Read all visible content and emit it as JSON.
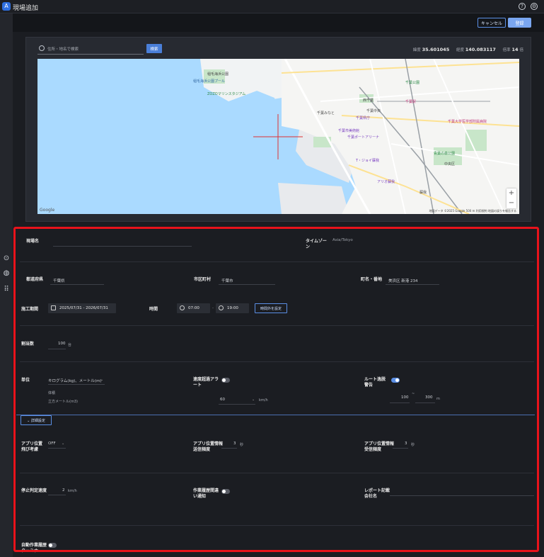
{
  "window": {
    "title": "現場追加",
    "logo_glyph": "A"
  },
  "actions": {
    "cancel_label": "キャンセル",
    "save_label": "登録"
  },
  "map_search": {
    "placeholder": "住所・地名で検索",
    "button_label": "検索",
    "lat_label": "緯度",
    "lat_value": "35.601045",
    "lng_label": "経度",
    "lng_value": "140.083117",
    "zoom_label": "倍率",
    "zoom_value": "14",
    "zoom_unit": "倍"
  },
  "map": {
    "labels": [
      {
        "text": "稲毛海浜公園",
        "cls": ""
      },
      {
        "text": "稲毛海浜公園プール",
        "cls": ""
      },
      {
        "text": "ZOZOマリンスタジアム",
        "cls": "gr"
      },
      {
        "text": "千葉ポートアリーナ",
        "cls": "pu"
      },
      {
        "text": "千葉市美術館",
        "cls": "pu"
      },
      {
        "text": "千葉県庁",
        "cls": "pu"
      },
      {
        "text": "千葉中央",
        "cls": ""
      },
      {
        "text": "千葉駅",
        "cls": "pk"
      },
      {
        "text": "千葉公園",
        "cls": "gr"
      },
      {
        "text": "青葉の森公園",
        "cls": "gr"
      },
      {
        "text": "T・ジョイ蘇我",
        "cls": "pu"
      },
      {
        "text": "アリオ蘇我",
        "cls": "pu"
      },
      {
        "text": "中央区",
        "cls": ""
      },
      {
        "text": "千葉みなと",
        "cls": ""
      },
      {
        "text": "西千葉",
        "cls": ""
      },
      {
        "text": "千葉大学医学部附属病院",
        "cls": "pk"
      },
      {
        "text": "蘇我",
        "cls": ""
      }
    ],
    "google_label": "Google",
    "attribution": "地図データ ©2025 Google  500 m  利用規約  地図の誤りを報告する",
    "zoom_in": "+",
    "zoom_out": "−"
  },
  "form": {
    "site_name": {
      "label": "現場名",
      "value": ""
    },
    "timezone": {
      "label": "タイムゾーン",
      "value": "Asia/Tokyo"
    },
    "prefecture": {
      "label": "都道府県",
      "value": "千葉県"
    },
    "city": {
      "label": "市区町村",
      "value": "千葉市"
    },
    "town": {
      "label": "町名・番地",
      "value": "美浜区 新港 234"
    },
    "period": {
      "label": "施工期間",
      "value": "2025/07/31 - 2026/07/31"
    },
    "time": {
      "label": "時間",
      "start": "07:00",
      "separator": "-",
      "end": "19:00",
      "button": "時間外を設定"
    },
    "allocation": {
      "label": "割当数",
      "value": "100",
      "unit": "台"
    },
    "unit": {
      "label": "単位",
      "value": "キログラム(kg)、メートル(m)",
      "sub_label": "体積",
      "sub_value": "立方メートル(m3)"
    },
    "speed_alert": {
      "label": "速度超過アラート",
      "on": false,
      "value": "60",
      "unit": "km/h"
    },
    "route_alert": {
      "label": "ルート逸脱警告",
      "on": true,
      "min": "100",
      "separator": "~",
      "max": "300",
      "unit": "m"
    },
    "advanced": {
      "label": "詳細設定"
    },
    "app_position": {
      "label": "アプリ位置飛び考慮",
      "value": "OFF"
    },
    "send_freq": {
      "label": "アプリ位置情報送信頻度",
      "value": "3",
      "unit": "秒"
    },
    "recv_freq": {
      "label": "アプリ位置情報受信頻度",
      "value": "3",
      "unit": "秒"
    },
    "stop_speed": {
      "label": "停止判定速度",
      "value": "2",
      "unit": "km/h"
    },
    "work_history": {
      "label": "作業履歴間違い通知",
      "on": false
    },
    "report_company": {
      "label": "レポート記載会社名",
      "value": ""
    },
    "auto_work": {
      "label": "自動作業履歴ターミナ",
      "on": false
    }
  }
}
